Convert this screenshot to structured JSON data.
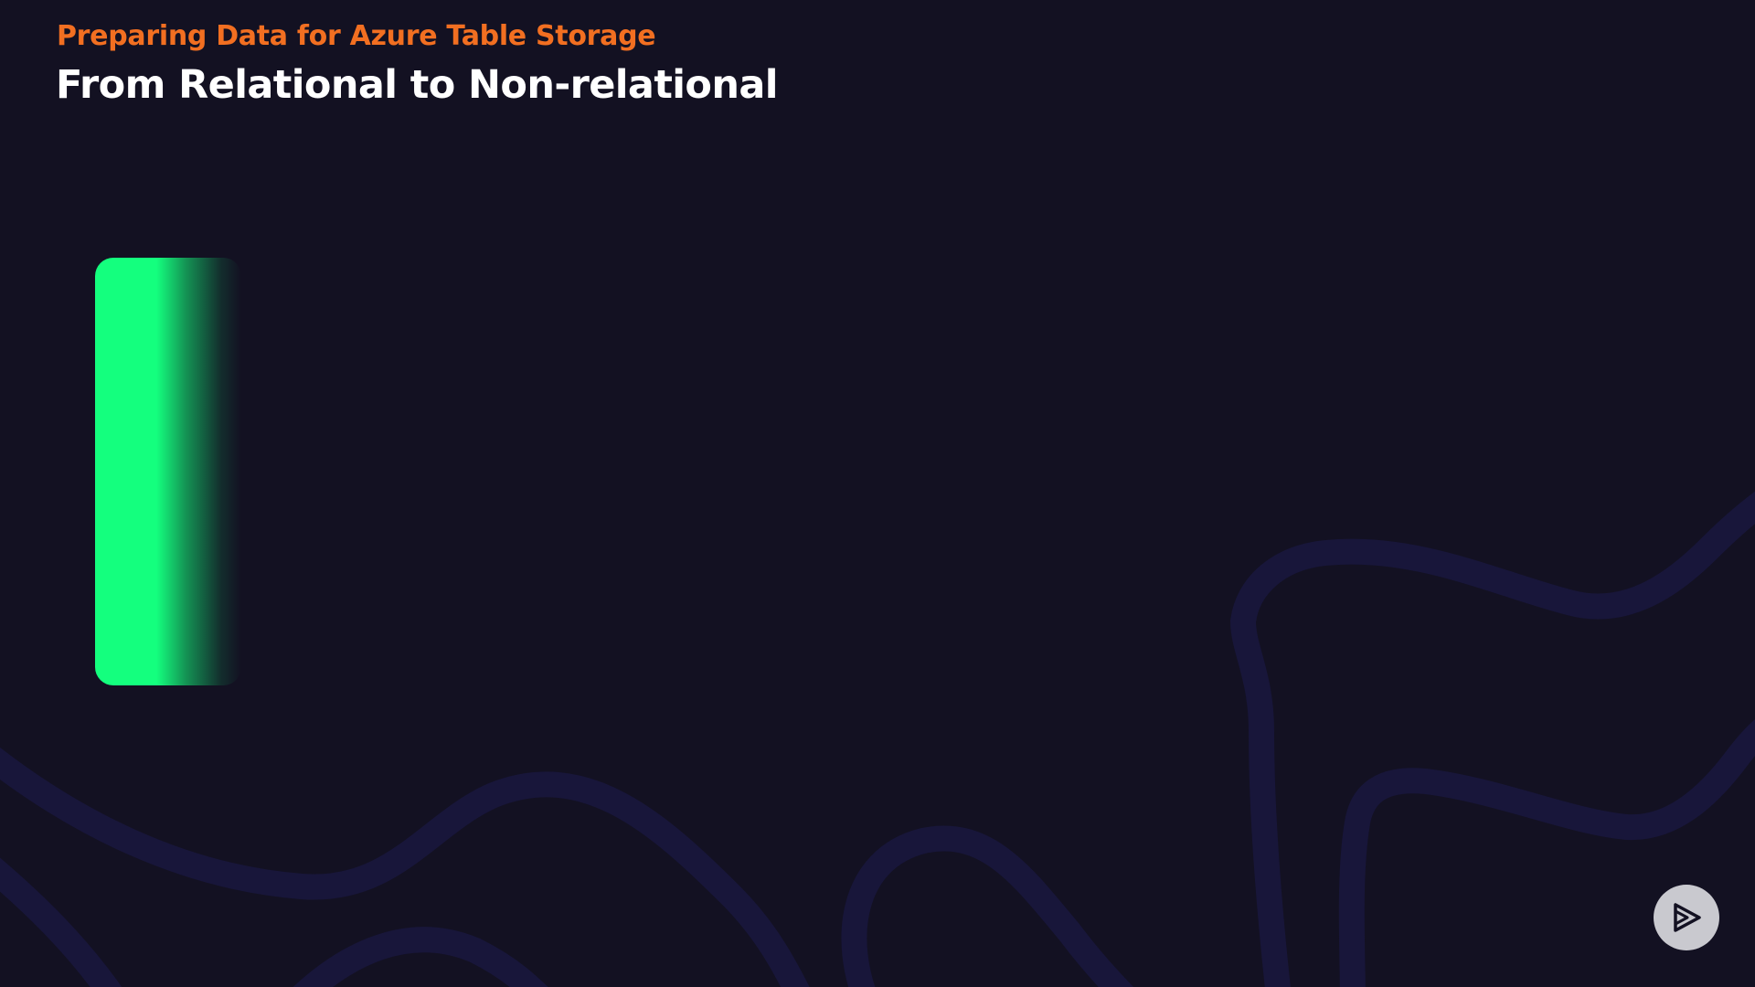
{
  "header": {
    "eyebrow": "Preparing Data for Azure Table Storage",
    "title": "From Relational to Non-relational"
  },
  "colors": {
    "background": "#131122",
    "eyebrow": "#F26F21",
    "title": "#FFFFFF",
    "panel": "#14FF7E",
    "waves": "#18163A",
    "badge": "#C9C9CF",
    "badge_icon": "#131122"
  },
  "icons": {
    "brand_badge": "play-logo-icon"
  }
}
